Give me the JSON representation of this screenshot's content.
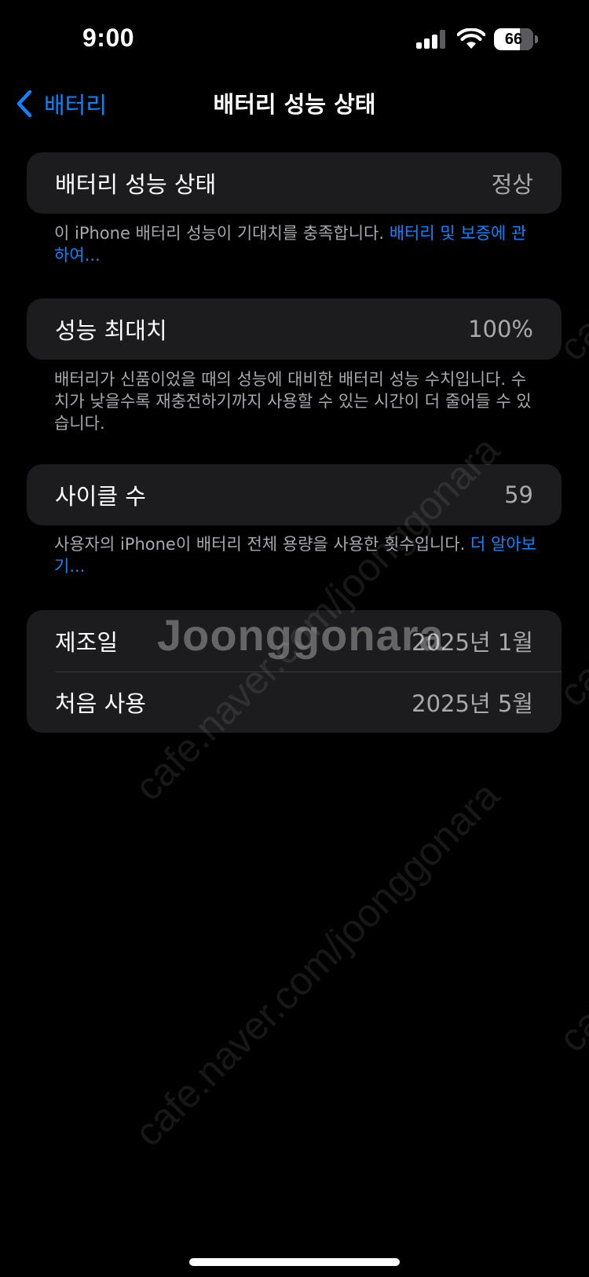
{
  "status_bar": {
    "time": "9:00",
    "battery_level": "66",
    "icons": [
      "cellular-signal-icon",
      "wifi-icon",
      "battery-icon"
    ]
  },
  "nav": {
    "back_label": "배터리",
    "title": "배터리 성능 상태"
  },
  "sections": {
    "health": {
      "label": "배터리 성능 상태",
      "value": "정상",
      "footnote": "이 iPhone 배터리 성능이 기대치를 충족합니다. ",
      "footnote_link": "배터리 및 보증에 관하여..."
    },
    "max_capacity": {
      "label": "성능 최대치",
      "value": "100%",
      "footnote": "배터리가 신품이었을 때의 성능에 대비한 배터리 성능 수치입니다. 수치가 낮을수록 재충전하기까지 사용할 수 있는 시간이 더 줄어들 수 있습니다."
    },
    "cycle_count": {
      "label": "사이클 수",
      "value": "59",
      "footnote": "사용자의 iPhone이 배터리 전체 용량을 사용한 횟수입니다. ",
      "footnote_link": "더 알아보기..."
    },
    "dates": {
      "manufacture_label": "제조일",
      "manufacture_value": "2025년 1월",
      "first_use_label": "처음 사용",
      "first_use_value": "2025년 5월"
    }
  },
  "watermark": {
    "url_text": "cafe.naver.com/joonggonara",
    "logo_text": "Joonggonara"
  },
  "colors": {
    "background": "#000000",
    "card": "#1c1c1e",
    "accent": "#0a84ff",
    "secondary_text": "#a8a8ad"
  }
}
